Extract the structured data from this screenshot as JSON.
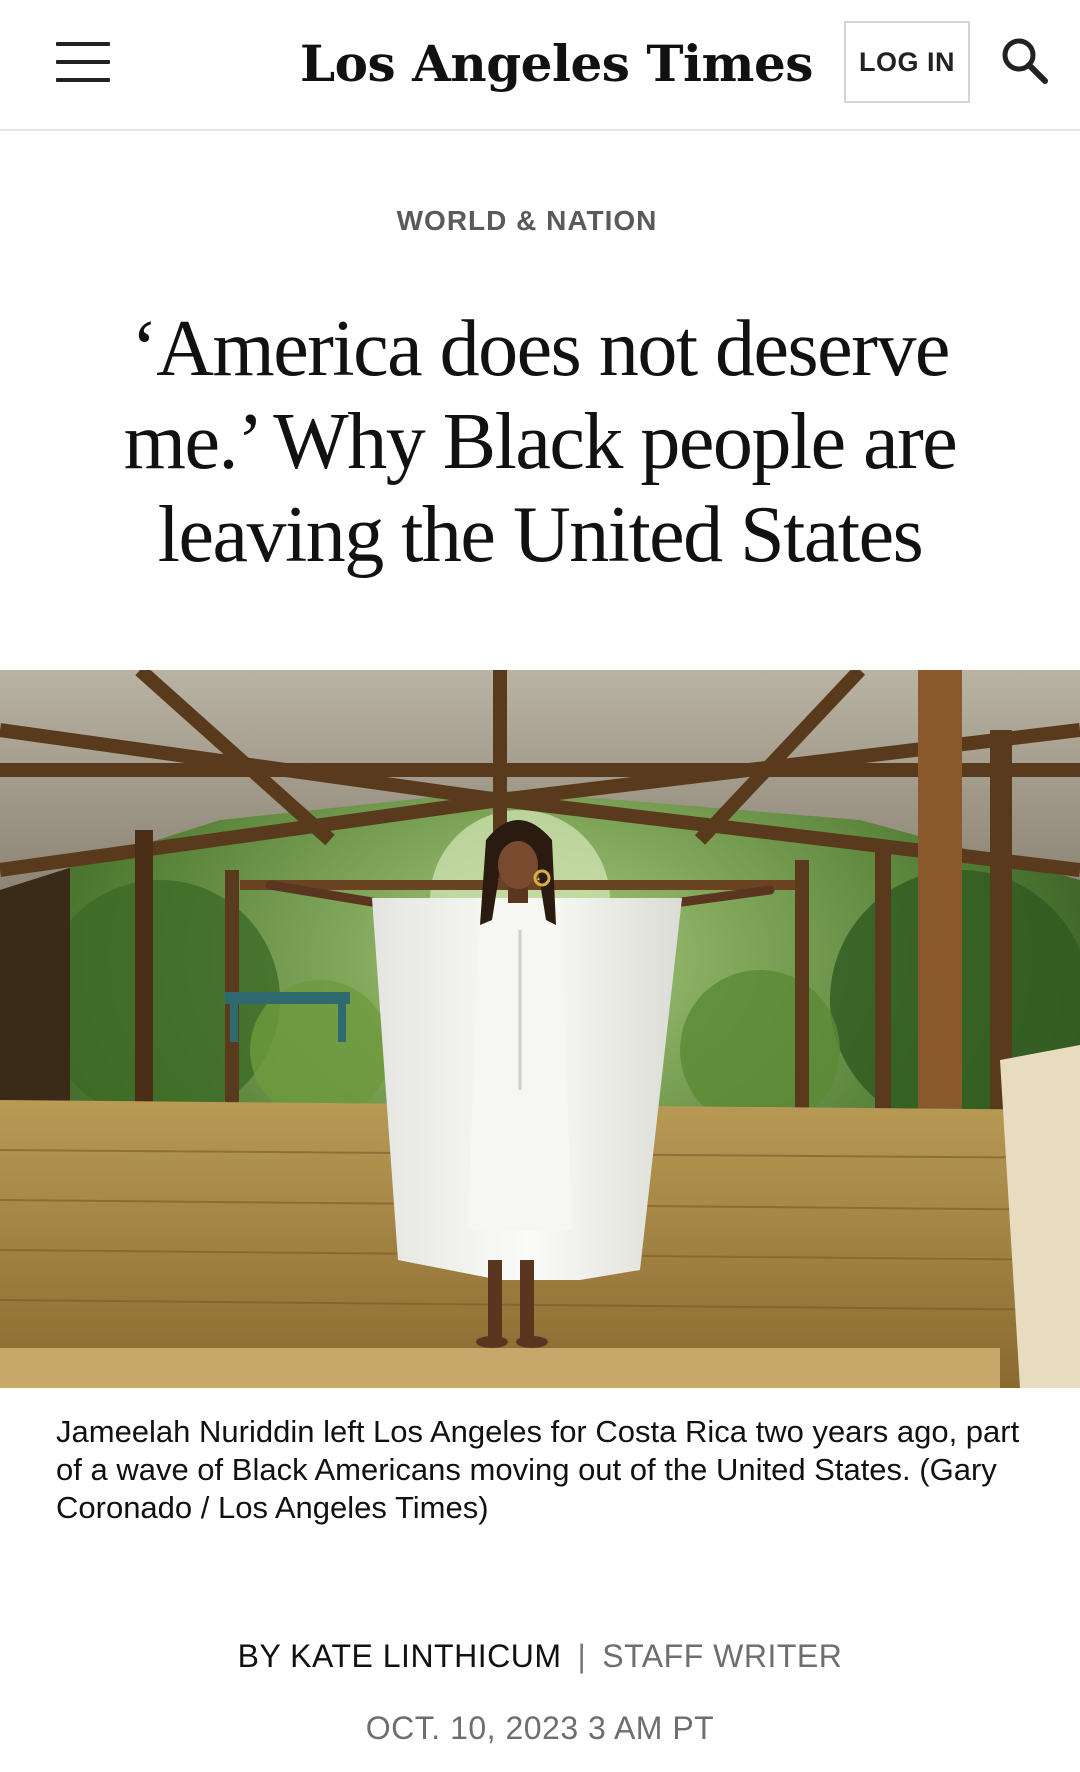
{
  "header": {
    "logo_text": "Los Angeles Times",
    "login_label": "LOG IN",
    "menu_icon": "hamburger-menu-icon",
    "search_icon": "search-icon"
  },
  "article": {
    "section": "WORLD & NATION",
    "headline": "‘America does not deserve me.’ Why Black people are leaving the United States",
    "caption": "Jameelah Nuriddin left Los Angeles for Costa Rica two years ago, part of a wave of Black Americans moving out of the United States. (Gary Coronado / Los Angeles Times)",
    "byline": {
      "author": "BY KATE LINTHICUM",
      "separator": "|",
      "role": "STAFF WRITER"
    },
    "date": "OCT. 10, 2023 3 AM PT"
  },
  "colors": {
    "text": "#111111",
    "muted": "#6e6e6e",
    "section": "#5a5a5a",
    "border": "#e6e6e6"
  }
}
